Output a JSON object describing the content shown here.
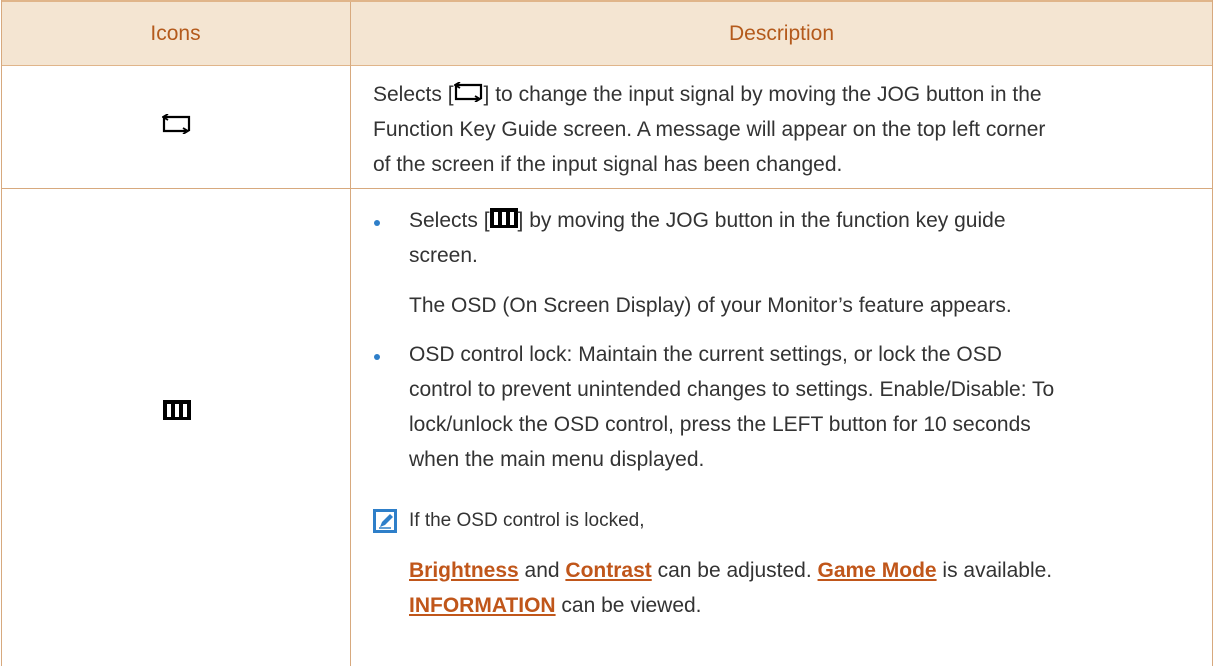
{
  "header": {
    "icons_label": "Icons",
    "description_label": "Description"
  },
  "row1": {
    "icon": "input-source-icon",
    "text_before": "Selects [",
    "text_after_line1": "] to change the input signal by moving the JOG button in the",
    "line2": "Function Key Guide screen. A message will appear on the top left corner",
    "line3": "of the screen if the input signal has been changed."
  },
  "row2": {
    "icon": "menu-icon",
    "bullet1": {
      "text_before": "Selects [",
      "text_after_line1": "] by moving the JOG button in the function key guide",
      "line2": "screen."
    },
    "osd_text": "The OSD (On Screen Display) of your Monitor’s feature appears.",
    "bullet2": {
      "line1": "OSD control lock: Maintain the current settings, or lock the OSD",
      "line2": "control to prevent unintended changes to settings. Enable/Disable: To",
      "line3": "lock/unlock the OSD control, press the LEFT button for 10 seconds",
      "line4": "when the main menu displayed."
    },
    "note": {
      "icon": "note-icon",
      "line1": "If the OSD control is locked,",
      "brightness": "Brightness",
      "and": " and ",
      "contrast": "Contrast",
      "can_be_adjusted": " can be adjusted. ",
      "game_mode": "Game Mode",
      "is_available": " is available.",
      "information": "INFORMATION",
      "can_be_viewed": " can be viewed."
    }
  },
  "colors": {
    "header_bg": "#f4e5d2",
    "header_text": "#b45a1c",
    "border": "#d7a97e",
    "link": "#c0561a",
    "bullet": "#2e7fc9"
  }
}
